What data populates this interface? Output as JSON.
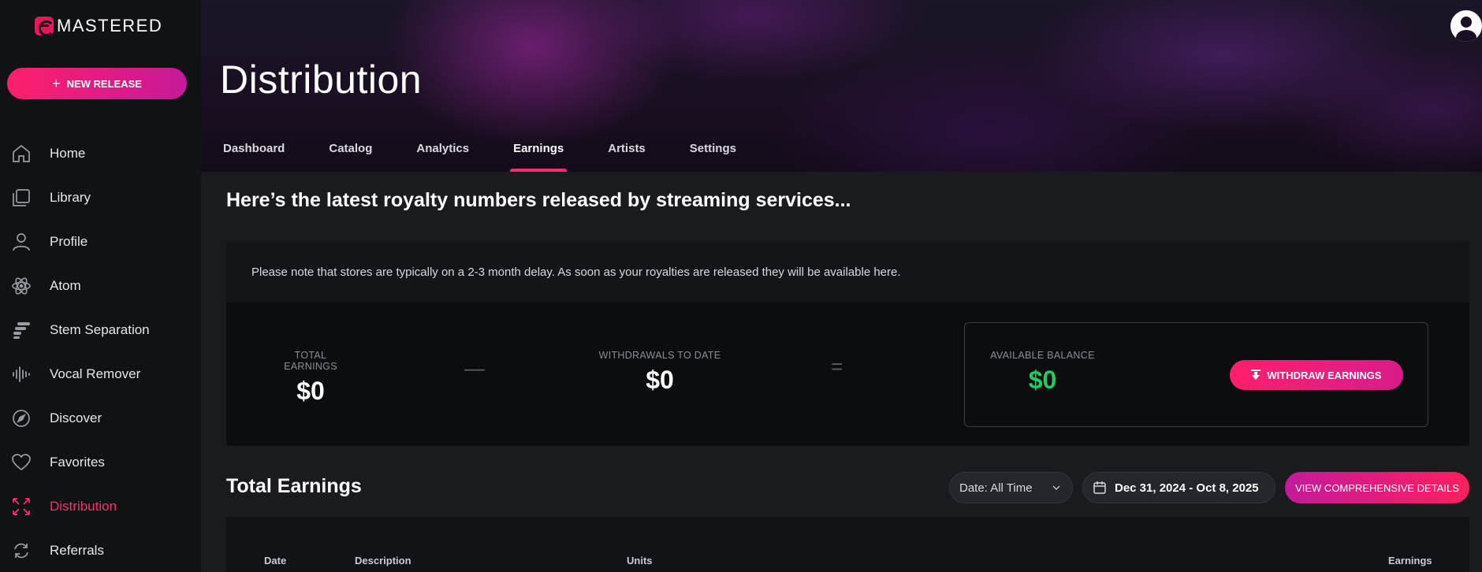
{
  "brand": {
    "name": "MASTERED"
  },
  "sidebar": {
    "new_release": "NEW RELEASE",
    "items": [
      {
        "label": "Home",
        "icon": "home-icon"
      },
      {
        "label": "Library",
        "icon": "library-icon"
      },
      {
        "label": "Profile",
        "icon": "user-icon"
      },
      {
        "label": "Atom",
        "icon": "atom-icon"
      },
      {
        "label": "Stem Separation",
        "icon": "stem-icon"
      },
      {
        "label": "Vocal Remover",
        "icon": "waveform-icon"
      },
      {
        "label": "Discover",
        "icon": "compass-icon"
      },
      {
        "label": "Favorites",
        "icon": "heart-icon"
      },
      {
        "label": "Distribution",
        "icon": "distribution-icon",
        "active": true
      },
      {
        "label": "Referrals",
        "icon": "refresh-icon"
      }
    ]
  },
  "header": {
    "title": "Distribution",
    "tabs": [
      {
        "label": "Dashboard"
      },
      {
        "label": "Catalog"
      },
      {
        "label": "Analytics"
      },
      {
        "label": "Earnings",
        "active": true
      },
      {
        "label": "Artists"
      },
      {
        "label": "Settings"
      }
    ]
  },
  "main": {
    "headline": "Here’s the latest royalty numbers released by streaming services...",
    "notice": "Please note that stores are typically on a 2-3 month delay. As soon as your royalties are released they will be available here.",
    "total_earnings_label": "TOTAL EARNINGS",
    "total_earnings_value": "$0",
    "withdrawals_label": "WITHDRAWALS TO DATE",
    "withdrawals_value": "$0",
    "balance_label": "AVAILABLE BALANCE",
    "balance_value": "$0",
    "withdraw_button": "WITHDRAW EARNINGS",
    "section_title": "Total Earnings",
    "date_filter": "Date: All Time",
    "date_range": "Dec 31, 2024 - Oct 8, 2025",
    "view_details_button": "VIEW COMPREHENSIVE DETAILS",
    "table_headers": {
      "date": "Date",
      "description": "Description",
      "units": "Units",
      "earnings": "Earnings"
    }
  },
  "colors": {
    "accent": "#ff2d6f",
    "positive": "#1ecb64",
    "sidebar_bg": "#111214",
    "main_bg": "#1a1b1e"
  }
}
